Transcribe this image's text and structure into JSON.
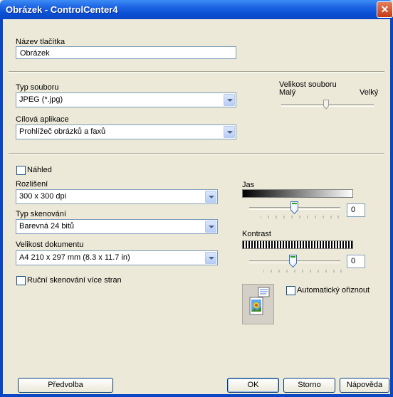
{
  "window": {
    "title": "Obrázek - ControlCenter4"
  },
  "button_name": {
    "label": "Název tlačítka",
    "value": "Obrázek"
  },
  "file_type": {
    "label": "Typ souboru",
    "value": "JPEG (*.jpg)"
  },
  "file_size": {
    "label": "Velikost souboru",
    "min_label": "Malý",
    "max_label": "Velký"
  },
  "target_app": {
    "label": "Cílová aplikace",
    "value": "Prohlížeč obrázků a faxů"
  },
  "preview": {
    "label": "Náhled"
  },
  "resolution": {
    "label": "Rozlišení",
    "value": "300 x 300 dpi"
  },
  "scan_type": {
    "label": "Typ skenování",
    "value": "Barevná 24 bitů"
  },
  "doc_size": {
    "label": "Velikost dokumentu",
    "value": "A4 210 x 297 mm (8.3 x 11.7 in)"
  },
  "manual_scan": {
    "label": "Ruční skenování více stran"
  },
  "brightness": {
    "label": "Jas",
    "value": "0"
  },
  "contrast": {
    "label": "Kontrast",
    "value": "0"
  },
  "auto_crop": {
    "label": "Automatický ořiznout"
  },
  "buttons": {
    "preset": "Předvolba",
    "ok": "OK",
    "cancel": "Storno",
    "help": "Nápověda"
  }
}
